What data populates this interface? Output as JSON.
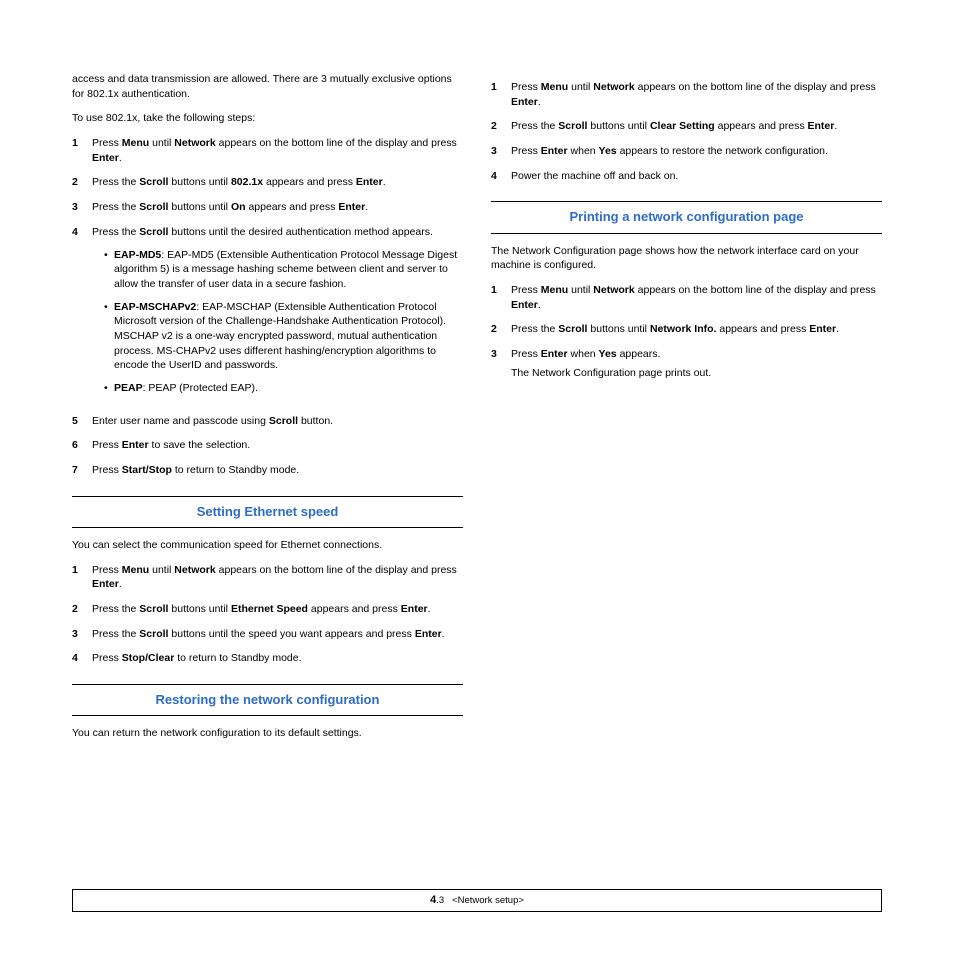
{
  "left": {
    "intro1": "access and data transmission are allowed. There are 3 mutually exclusive options for 802.1x authentication.",
    "intro2": "To use 802.1x, take the following steps:",
    "steps": [
      {
        "n": "1",
        "pre": "Press ",
        "b1": "Menu",
        "mid": " until ",
        "b2": "Network",
        "post": " appears on the bottom line of the display and press ",
        "b3": "Enter",
        "tail": "."
      },
      {
        "n": "2",
        "pre": "Press the ",
        "b1": "Scroll",
        "mid": " buttons until ",
        "b2": "802.1x",
        "post": " appears and press ",
        "b3": "Enter",
        "tail": "."
      },
      {
        "n": "3",
        "pre": "Press the ",
        "b1": "Scroll",
        "mid": " buttons until ",
        "b2": "On",
        "post": " appears and press ",
        "b3": "Enter",
        "tail": "."
      },
      {
        "n": "4",
        "pre": "Press the ",
        "b1": "Scroll",
        "mid": " buttons until the desired authentication method appears.",
        "has_sub": true,
        "sub": [
          {
            "label": "EAP-MD5",
            "text": ": EAP-MD5 (Extensible Authentication Protocol Message Digest algorithm 5) is a message hashing scheme between client and server to allow the transfer of user data in a secure fashion."
          },
          {
            "label": "EAP-MSCHAPv2",
            "text": ": EAP-MSCHAP (Extensible Authentication Protocol Microsoft version of the Challenge-Handshake Authentication Protocol). MSCHAP v2 is a one-way encrypted password, mutual authentication process. MS-CHAPv2 uses different hashing/encryption algorithms to encode the UserID and passwords."
          },
          {
            "label": "PEAP",
            "text": ": PEAP (Protected EAP)."
          }
        ]
      },
      {
        "n": "5",
        "pre": "Enter user name and passcode using ",
        "b1": "Scroll",
        "mid": " button."
      },
      {
        "n": "6",
        "pre": "Press ",
        "b1": "Enter",
        "mid": " to save the selection."
      },
      {
        "n": "7",
        "pre": "Press ",
        "b1": "Start/Stop",
        "mid": " to return to Standby mode."
      }
    ],
    "sec1_title": "Setting Ethernet speed",
    "sec1_intro": "You can select the communication speed for Ethernet connections.",
    "sec1_steps": [
      {
        "n": "1",
        "pre": "Press ",
        "b1": "Menu",
        "mid": " until ",
        "b2": "Network",
        "post": " appears on the bottom line of the display and press ",
        "b3": "Enter",
        "tail": "."
      },
      {
        "n": "2",
        "pre": "Press the ",
        "b1": "Scroll",
        "mid": " buttons until ",
        "b2": "Ethernet Speed",
        "post": " appears and press ",
        "b3": "Enter",
        "tail": "."
      },
      {
        "n": "3",
        "pre": "Press the ",
        "b1": "Scroll",
        "mid": " buttons until the speed you want appears and press ",
        "b2": "Enter",
        "post": "."
      },
      {
        "n": "4",
        "pre": "Press ",
        "b1": "Stop/Clear",
        "mid": " to return to Standby mode."
      }
    ],
    "sec2_title": "Restoring the network configuration",
    "sec2_intro": "You can return the network configuration to its default settings."
  },
  "right": {
    "steps": [
      {
        "n": "1",
        "pre": "Press ",
        "b1": "Menu",
        "mid": " until ",
        "b2": "Network",
        "post": " appears on the bottom line of the display and press ",
        "b3": "Enter",
        "tail": "."
      },
      {
        "n": "2",
        "pre": "Press the ",
        "b1": "Scroll",
        "mid": " buttons until ",
        "b2": "Clear Setting",
        "post": " appears and press ",
        "b3": "Enter",
        "tail": "."
      },
      {
        "n": "3",
        "pre": "Press ",
        "b1": "Enter",
        "mid": " when ",
        "b2": "Yes",
        "post": " appears to restore the network configuration."
      },
      {
        "n": "4",
        "pre": "Power the machine off and back on."
      }
    ],
    "sec_title": "Printing a network configuration page",
    "sec_intro": "The Network Configuration page shows how the network interface card on your machine is configured.",
    "sec_steps": [
      {
        "n": "1",
        "pre": "Press ",
        "b1": "Menu",
        "mid": " until ",
        "b2": "Network",
        "post": " appears on the bottom line of the display and press ",
        "b3": "Enter",
        "tail": "."
      },
      {
        "n": "2",
        "pre": "Press the ",
        "b1": "Scroll",
        "mid": " buttons until ",
        "b2": "Network Info.",
        "post": " appears and press ",
        "b3": "Enter",
        "tail": "."
      },
      {
        "n": "3",
        "pre": "Press ",
        "b1": "Enter",
        "mid": " when ",
        "b2": "Yes",
        "post": " appears.",
        "after": "The Network Configuration page prints out."
      }
    ]
  },
  "footer": {
    "chap": "4",
    "page": ".3",
    "label": "<Network setup>"
  }
}
